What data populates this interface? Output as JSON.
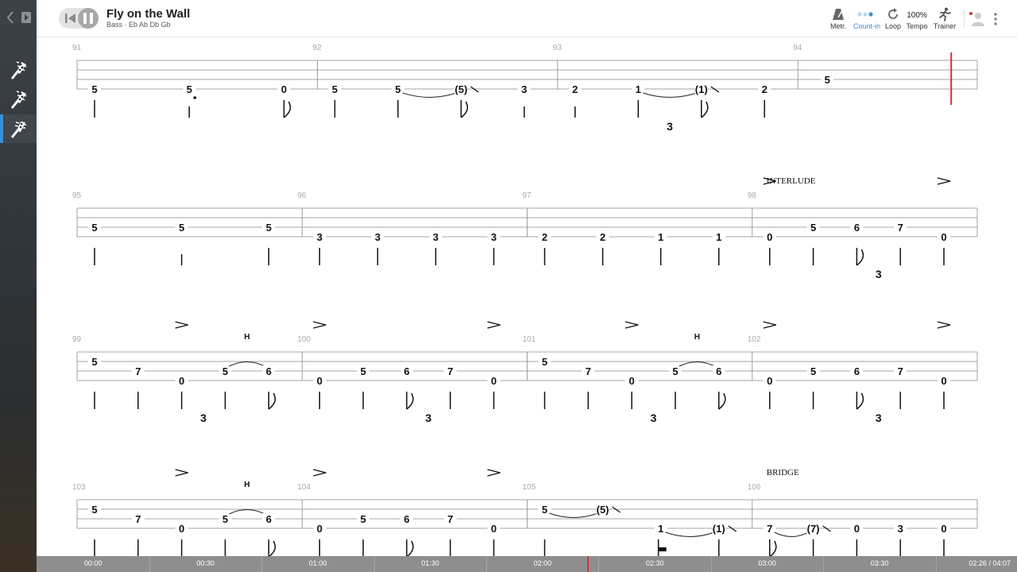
{
  "sidebar": {
    "nav_back": "back",
    "nav_panel": "panel-toggle",
    "tracks": [
      {
        "icon": "guitar-headstock-icon",
        "active": false
      },
      {
        "icon": "guitar-headstock-icon",
        "active": false
      },
      {
        "icon": "bass-headstock-icon",
        "active": true
      }
    ]
  },
  "header": {
    "title": "Fly on the Wall",
    "instrument": "Bass",
    "separator": "·",
    "tuning": "Eb Ab Db Gb"
  },
  "toolbar": {
    "metronome": "Metr.",
    "count_in": "Count-in",
    "loop": "Loop",
    "tempo_value": "100%",
    "tempo": "Tempo",
    "trainer": "Trainer"
  },
  "colors": {
    "accent": "#3a8fd9",
    "cursor": "#d0323a",
    "timeline_bg": "#8e8e8e"
  },
  "score": {
    "systems": [
      {
        "measures": [
          {
            "number": "91",
            "notes": [
              {
                "f": "5",
                "s": 4,
                "st": "q"
              },
              {
                "f": "5",
                "s": 4,
                "st": "q",
                "dot": true,
                "short": true
              },
              {
                "f": "0",
                "s": 4,
                "st": "e"
              }
            ]
          },
          {
            "number": "92",
            "notes": [
              {
                "f": "5",
                "s": 4,
                "st": "q"
              },
              {
                "f": "5",
                "s": 4,
                "st": "q",
                "tie": true
              },
              {
                "f": "(5)",
                "s": 4,
                "st": "e",
                "slide": true
              },
              {
                "f": "3",
                "s": 4,
                "st": "q",
                "short": true
              }
            ]
          },
          {
            "number": "93",
            "notes": [
              {
                "f": "2",
                "s": 4,
                "st": "q",
                "short": true
              },
              {
                "f": "1",
                "s": 4,
                "st": "q",
                "tie": true
              },
              {
                "f": "(1)",
                "s": 4,
                "st": "e",
                "slide": true
              },
              {
                "f": "2",
                "s": 4,
                "st": "q"
              }
            ],
            "triplet": "3"
          },
          {
            "number": "94",
            "notes": [
              {
                "f": "5",
                "s": 3,
                "st": "none"
              }
            ],
            "cursor": true
          }
        ]
      },
      {
        "measures": [
          {
            "number": "95",
            "notes": [
              {
                "f": "5",
                "s": 3,
                "st": "q"
              },
              {
                "f": "5",
                "s": 3,
                "st": "q",
                "short": true
              },
              {
                "f": "5",
                "s": 3,
                "st": "q"
              }
            ]
          },
          {
            "number": "96",
            "notes": [
              {
                "f": "3",
                "s": 4,
                "st": "q"
              },
              {
                "f": "3",
                "s": 4,
                "st": "q"
              },
              {
                "f": "3",
                "s": 4,
                "st": "q"
              },
              {
                "f": "3",
                "s": 4,
                "st": "q"
              }
            ]
          },
          {
            "number": "97",
            "notes": [
              {
                "f": "2",
                "s": 4,
                "st": "q"
              },
              {
                "f": "2",
                "s": 4,
                "st": "q"
              },
              {
                "f": "1",
                "s": 4,
                "st": "q"
              },
              {
                "f": "1",
                "s": 4,
                "st": "q"
              }
            ]
          },
          {
            "number": "98",
            "section": "INTERLUDE",
            "notes": [
              {
                "f": "0",
                "s": 4,
                "st": "q",
                "accent": true
              },
              {
                "f": "5",
                "s": 3,
                "st": "q"
              },
              {
                "f": "6",
                "s": 3,
                "st": "e"
              },
              {
                "f": "7",
                "s": 3,
                "st": "q"
              },
              {
                "f": "0",
                "s": 4,
                "st": "q",
                "accent": true
              }
            ],
            "triplet": "3"
          }
        ]
      },
      {
        "measures": [
          {
            "number": "99",
            "notes": [
              {
                "f": "5",
                "s": 2,
                "st": "q"
              },
              {
                "f": "7",
                "s": 3,
                "st": "q"
              },
              {
                "f": "0",
                "s": 4,
                "st": "q",
                "accent": true
              },
              {
                "f": "5",
                "s": 3,
                "st": "q",
                "hammer": true
              },
              {
                "f": "6",
                "s": 3,
                "st": "e"
              }
            ],
            "triplet": "3",
            "hammer_label": "H"
          },
          {
            "number": "100",
            "notes": [
              {
                "f": "0",
                "s": 4,
                "st": "q",
                "accent": true
              },
              {
                "f": "5",
                "s": 3,
                "st": "q"
              },
              {
                "f": "6",
                "s": 3,
                "st": "e"
              },
              {
                "f": "7",
                "s": 3,
                "st": "q"
              },
              {
                "f": "0",
                "s": 4,
                "st": "q",
                "accent": true
              }
            ],
            "triplet": "3"
          },
          {
            "number": "101",
            "notes": [
              {
                "f": "5",
                "s": 2,
                "st": "q"
              },
              {
                "f": "7",
                "s": 3,
                "st": "q"
              },
              {
                "f": "0",
                "s": 4,
                "st": "q",
                "accent": true
              },
              {
                "f": "5",
                "s": 3,
                "st": "q",
                "hammer": true
              },
              {
                "f": "6",
                "s": 3,
                "st": "e"
              }
            ],
            "triplet": "3",
            "hammer_label": "H"
          },
          {
            "number": "102",
            "notes": [
              {
                "f": "0",
                "s": 4,
                "st": "q",
                "accent": true
              },
              {
                "f": "5",
                "s": 3,
                "st": "q"
              },
              {
                "f": "6",
                "s": 3,
                "st": "e"
              },
              {
                "f": "7",
                "s": 3,
                "st": "q"
              },
              {
                "f": "0",
                "s": 4,
                "st": "q",
                "accent": true
              }
            ],
            "triplet": "3"
          }
        ]
      },
      {
        "measures": [
          {
            "number": "103",
            "notes": [
              {
                "f": "5",
                "s": 2,
                "st": "q"
              },
              {
                "f": "7",
                "s": 3,
                "st": "q"
              },
              {
                "f": "0",
                "s": 4,
                "st": "q",
                "accent": true
              },
              {
                "f": "5",
                "s": 3,
                "st": "q",
                "hammer": true
              },
              {
                "f": "6",
                "s": 3,
                "st": "e"
              }
            ],
            "hammer_label": "H"
          },
          {
            "number": "104",
            "notes": [
              {
                "f": "0",
                "s": 4,
                "st": "q",
                "accent": true
              },
              {
                "f": "5",
                "s": 3,
                "st": "q"
              },
              {
                "f": "6",
                "s": 3,
                "st": "e"
              },
              {
                "f": "7",
                "s": 3,
                "st": "q"
              },
              {
                "f": "0",
                "s": 4,
                "st": "q",
                "accent": true
              }
            ]
          },
          {
            "number": "105",
            "notes": [
              {
                "f": "5",
                "s": 2,
                "st": "q",
                "tie": true
              },
              {
                "f": "(5)",
                "s": 2,
                "st": "none",
                "slide": true
              },
              {
                "f": "1",
                "s": 4,
                "st": "rest",
                "tie": true
              },
              {
                "f": "(1)",
                "s": 4,
                "st": "q",
                "slide": true
              }
            ]
          },
          {
            "number": "106",
            "section": "BRIDGE",
            "notes": [
              {
                "f": "7",
                "s": 4,
                "st": "e",
                "tie": true
              },
              {
                "f": "(7)",
                "s": 4,
                "st": "q",
                "slide": true
              },
              {
                "f": "0",
                "s": 4,
                "st": "q"
              },
              {
                "f": "3",
                "s": 4,
                "st": "q"
              },
              {
                "f": "0",
                "s": 4,
                "st": "q"
              }
            ]
          }
        ]
      }
    ]
  },
  "timeline": {
    "labels": [
      "00:00",
      "00:30",
      "01:00",
      "01:30",
      "02:00",
      "02:30",
      "03:00",
      "03:30"
    ],
    "position": "02:26",
    "separator": "/",
    "duration": "04:07",
    "progress": 0.591
  }
}
